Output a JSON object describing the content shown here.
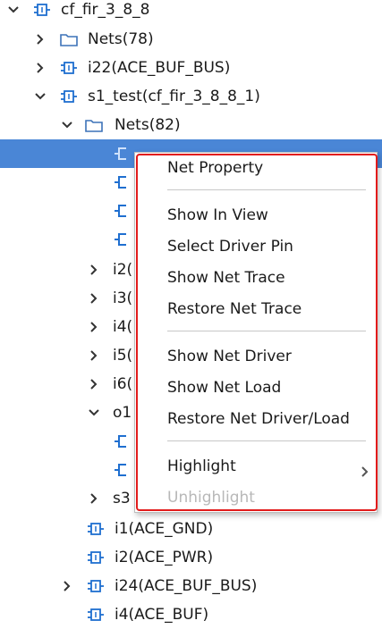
{
  "tree": {
    "rows": [
      {
        "label": "cf_fir_3_8_8"
      },
      {
        "label": "Nets(78)"
      },
      {
        "label": "i22(ACE_BUF_BUS)"
      },
      {
        "label": "s1_test(cf_fir_3_8_8_1)"
      },
      {
        "label": "Nets(82)"
      },
      {
        "label": ""
      },
      {
        "label": ""
      },
      {
        "label": ""
      },
      {
        "label": ""
      },
      {
        "label": "i2("
      },
      {
        "label": "i3("
      },
      {
        "label": "i4("
      },
      {
        "label": "i5("
      },
      {
        "label": "i6("
      },
      {
        "label": "o1"
      },
      {
        "label": ""
      },
      {
        "label": ""
      },
      {
        "label": "s3"
      },
      {
        "label": "i1(ACE_GND)"
      },
      {
        "label": "i2(ACE_PWR)"
      },
      {
        "label": "i24(ACE_BUF_BUS)"
      },
      {
        "label": "i4(ACE_BUF)"
      }
    ]
  },
  "context_menu": {
    "items": [
      {
        "label": "Net Property"
      },
      {
        "label": "Show In View"
      },
      {
        "label": "Select Driver Pin"
      },
      {
        "label": "Show Net Trace"
      },
      {
        "label": "Restore Net Trace"
      },
      {
        "label": "Show Net Driver"
      },
      {
        "label": "Show Net Load"
      },
      {
        "label": "Restore Net Driver/Load"
      },
      {
        "label": "Highlight"
      },
      {
        "label": "Unhighlight"
      }
    ]
  },
  "colors": {
    "selection": "#4a86d6",
    "icon_blue": "#1f6fd0",
    "highlight_border": "#e21b1b",
    "disabled_text": "#b8b8b8"
  }
}
